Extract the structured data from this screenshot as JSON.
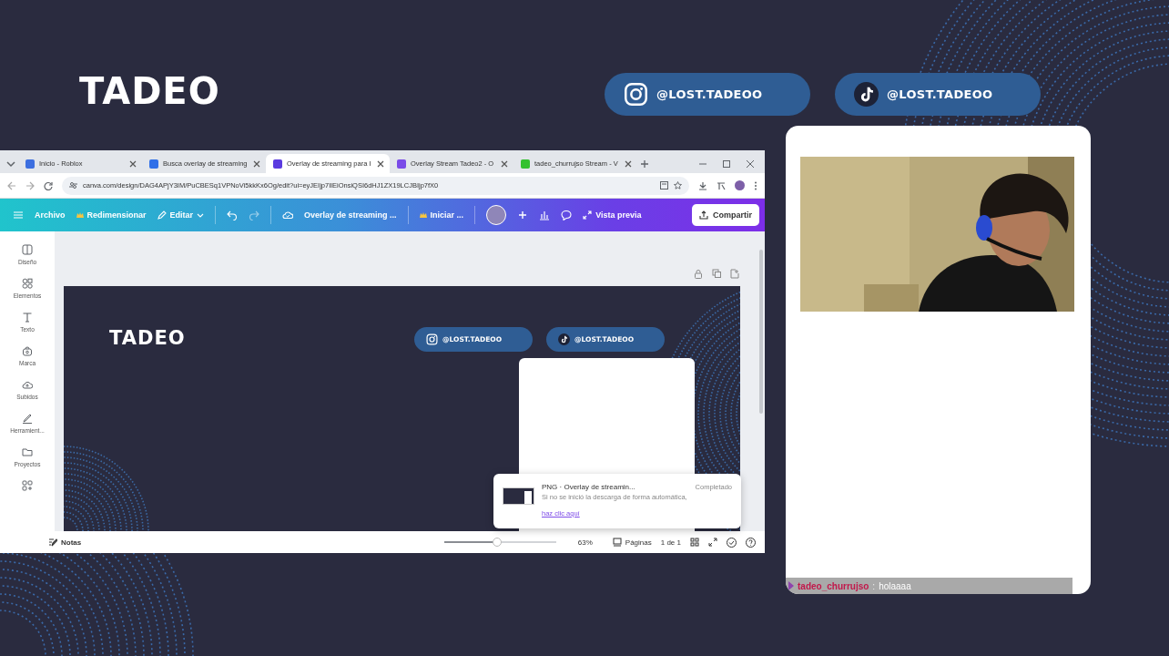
{
  "overlay": {
    "logo": "TADEO",
    "socials": [
      {
        "kind": "instagram",
        "handle": "@LOST.TADEOO"
      },
      {
        "kind": "tiktok",
        "handle": "@LOST.TADEOO"
      }
    ]
  },
  "browser": {
    "tabs": [
      {
        "kind": "roblox",
        "label": "Inicio - Roblox",
        "selected": false
      },
      {
        "kind": "search",
        "label": "Busca overlay de streaming",
        "selected": false
      },
      {
        "kind": "canva",
        "label": "Overlay de streaming para I",
        "selected": true
      },
      {
        "kind": "chat",
        "label": "Overlay Stream Tadeo2 - O",
        "selected": false
      },
      {
        "kind": "kick",
        "label": "tadeo_churrujso Stream - V",
        "selected": false
      }
    ],
    "url": "canva.com/design/DAG4APjY3IM/PuCBESq1VPNoVi5kkKx6Og/edit?ui=eyJEIjp7IlEiOnsiQSI6dHJ1ZX19LCJBIjp7fX0"
  },
  "editor": {
    "toolbar": {
      "file": "Archivo",
      "resize": "Redimensionar",
      "edit": "Editar",
      "doc_title": "Overlay de streaming ...",
      "start": "Iniciar ...",
      "preview": "Vista previa",
      "share": "Compartir"
    },
    "sidebar": [
      {
        "kind": "design",
        "label": "Diseño"
      },
      {
        "kind": "elements",
        "label": "Elementos"
      },
      {
        "kind": "text",
        "label": "Texto"
      },
      {
        "kind": "brand",
        "label": "Marca"
      },
      {
        "kind": "uploads",
        "label": "Subidos"
      },
      {
        "kind": "tools",
        "label": "Herramient..."
      },
      {
        "kind": "projects",
        "label": "Proyectos"
      },
      {
        "kind": "apps"
      }
    ],
    "design": {
      "logo": "TADEO",
      "socials": [
        {
          "kind": "instagram",
          "handle": "@LOST.TADEOO"
        },
        {
          "kind": "tiktok",
          "handle": "@LOST.TADEOO"
        }
      ]
    },
    "download": {
      "title": "PNG · Overlay de streamin...",
      "status": "Completado",
      "message": "Si no se inició la descarga de forma automática,",
      "link": "haz clic aquí"
    },
    "footer": {
      "notes": "Notas",
      "zoom": {
        "level": 0.47
      },
      "zoom_reading": "63%",
      "pages": "Páginas",
      "page_count": "1 de 1"
    }
  },
  "chat": [
    {
      "user": "tadeo_churrujso",
      "separator": ":",
      "message": "holaaaa"
    }
  ]
}
